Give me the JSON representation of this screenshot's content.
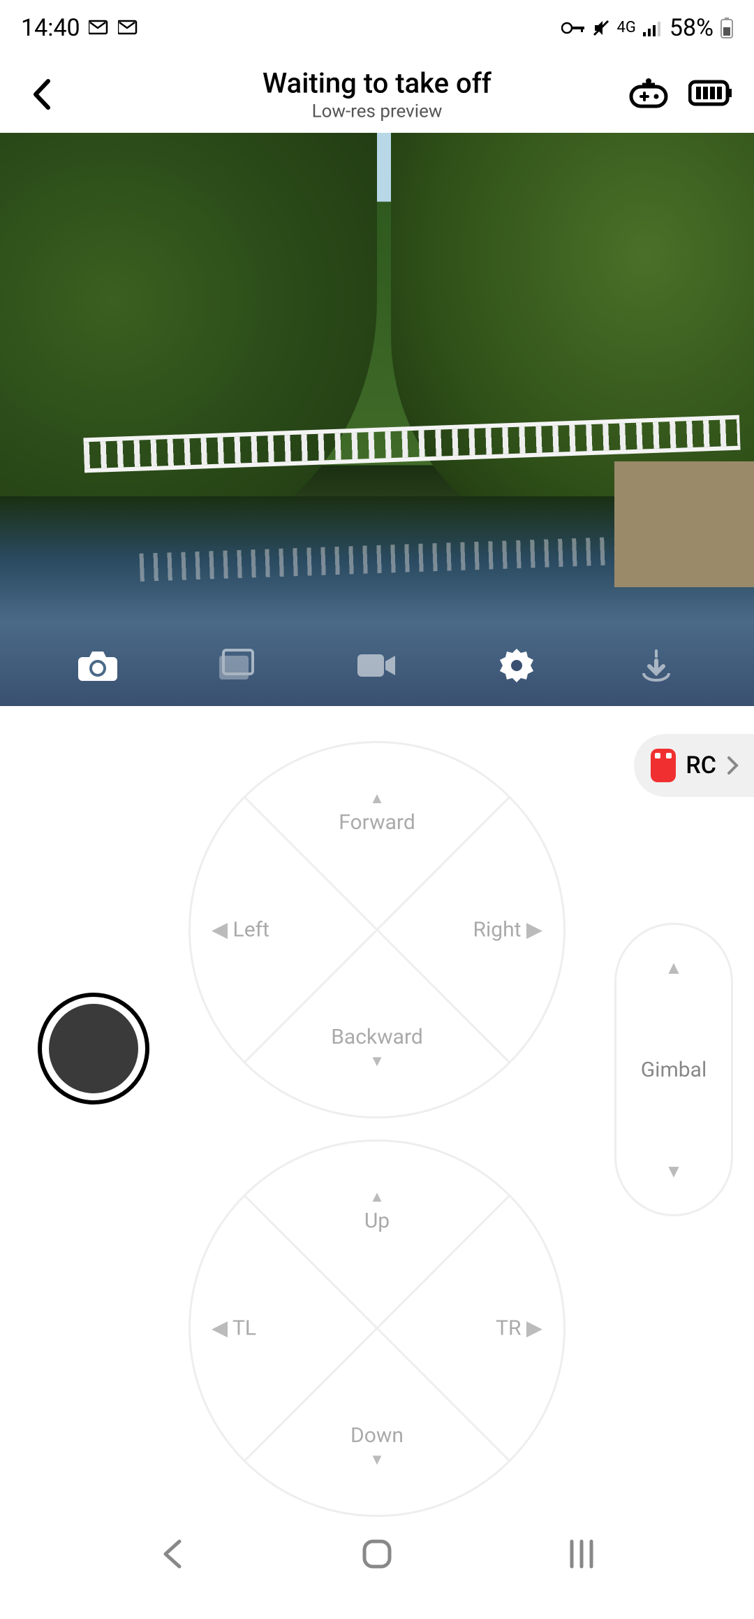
{
  "status": {
    "time": "14:40",
    "network": "4G",
    "battery": "58%"
  },
  "header": {
    "title": "Waiting to take off",
    "subtitle": "Low-res preview"
  },
  "rc": {
    "label": "RC"
  },
  "joystick1": {
    "top": "Forward",
    "bottom": "Backward",
    "left": "Left",
    "right": "Right"
  },
  "joystick2": {
    "top": "Up",
    "bottom": "Down",
    "left": "TL",
    "right": "TR"
  },
  "gimbal": {
    "label": "Gimbal"
  }
}
